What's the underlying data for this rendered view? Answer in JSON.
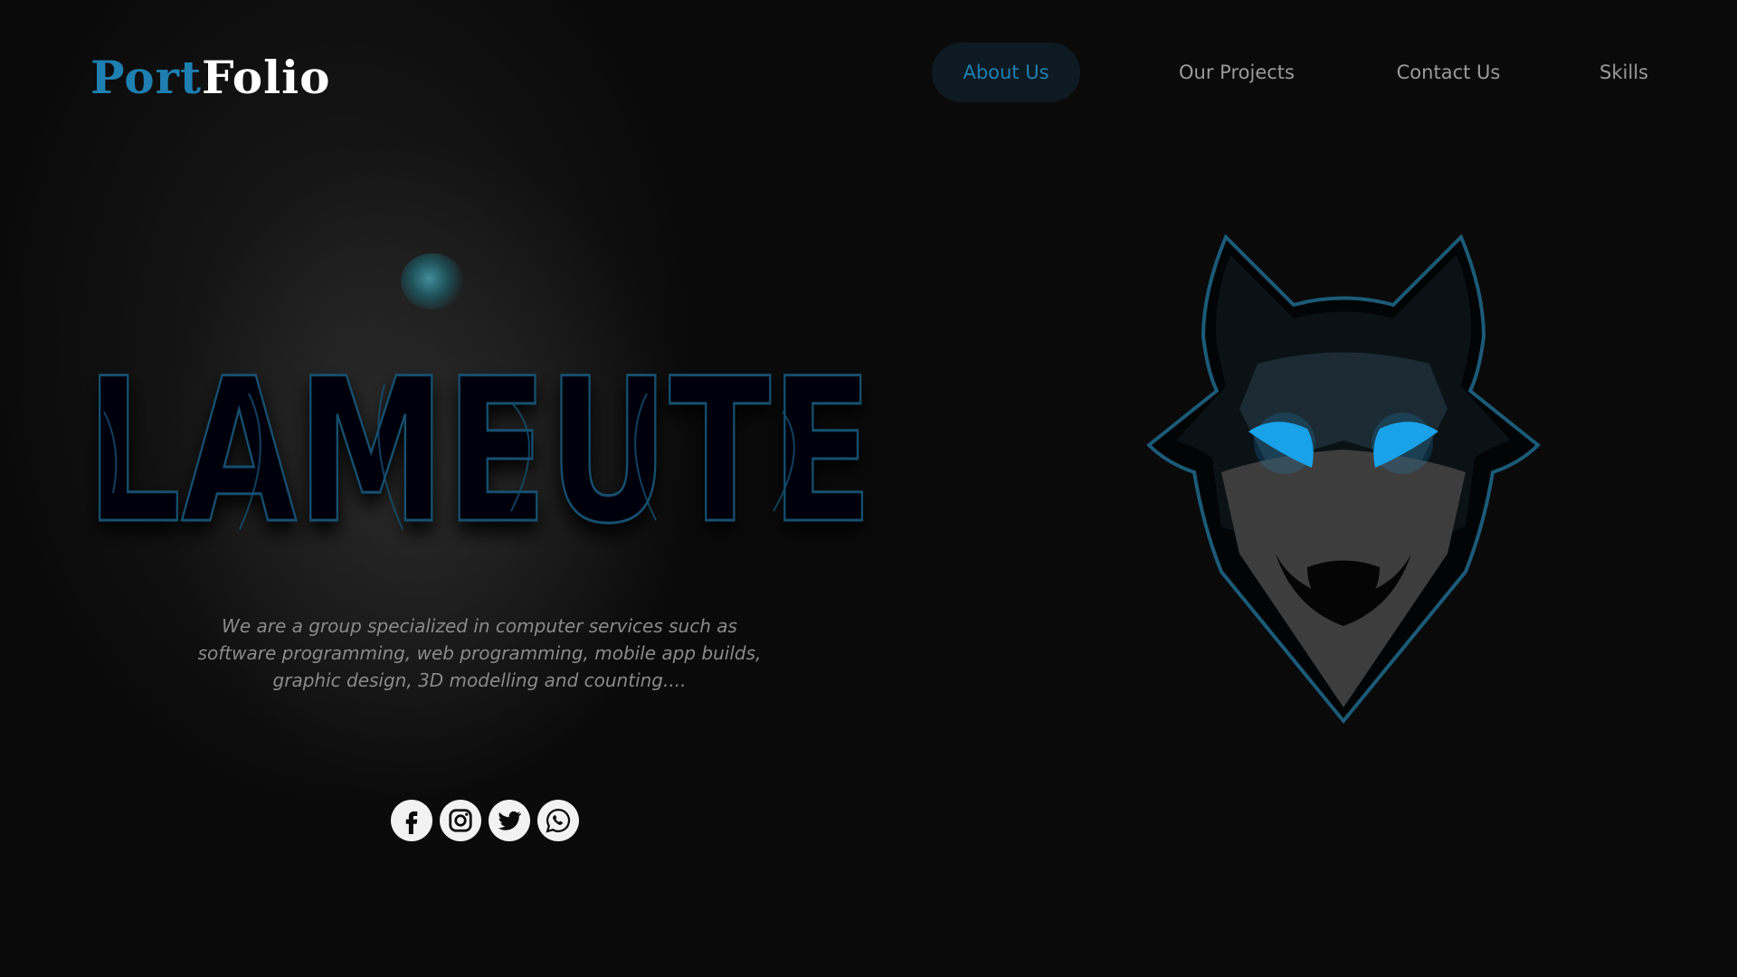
{
  "brand": {
    "part1": "Port",
    "part2": "Folio"
  },
  "nav": {
    "items": [
      {
        "label": "About Us",
        "active": true
      },
      {
        "label": "Our Projects",
        "active": false
      },
      {
        "label": "Contact Us",
        "active": false
      },
      {
        "label": "Skills",
        "active": false
      }
    ]
  },
  "hero": {
    "title": "LAMEUTE",
    "tagline_line1": "We are a group specialized in computer services such as",
    "tagline_line2": "software programming, web programming, mobile app builds,",
    "tagline_line3": "graphic design, 3D modelling and counting...."
  },
  "socials": [
    {
      "name": "facebook",
      "icon": "facebook-icon"
    },
    {
      "name": "instagram",
      "icon": "instagram-icon"
    },
    {
      "name": "twitter",
      "icon": "twitter-icon"
    },
    {
      "name": "whatsapp",
      "icon": "whatsapp-icon"
    }
  ],
  "colors": {
    "accent": "#1e7fb0",
    "eye_glow": "#19a3e8",
    "background": "#0a0a0a",
    "nav_text": "#9a9a9a"
  }
}
